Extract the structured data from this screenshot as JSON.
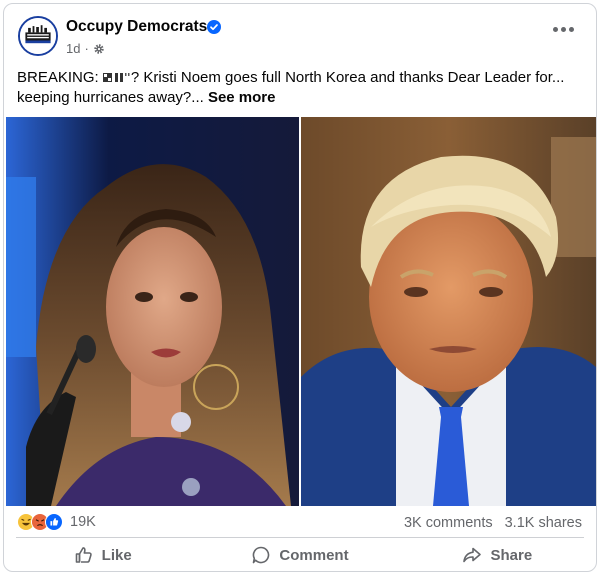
{
  "post": {
    "page_name": "Occupy Democrats",
    "time": "1d",
    "privacy_icon": "gear-icon",
    "avatar_text": "OCCUPY DEMOCRATS",
    "text_prefix": "BREAKING: ",
    "text_body": "? Kristi Noem goes full North Korea and thanks Dear Leader for... keeping hurricanes away?...",
    "see_more": "See more"
  },
  "stats": {
    "reaction_count": "19K",
    "comments": "3K comments",
    "shares": "3.1K shares",
    "reaction_icons": [
      "haha-icon",
      "angry-icon",
      "like-reaction-icon"
    ]
  },
  "actions": {
    "like": "Like",
    "comment": "Comment",
    "share": "Share"
  },
  "colors": {
    "brand_blue": "#0866ff",
    "text_secondary": "#65676b"
  }
}
